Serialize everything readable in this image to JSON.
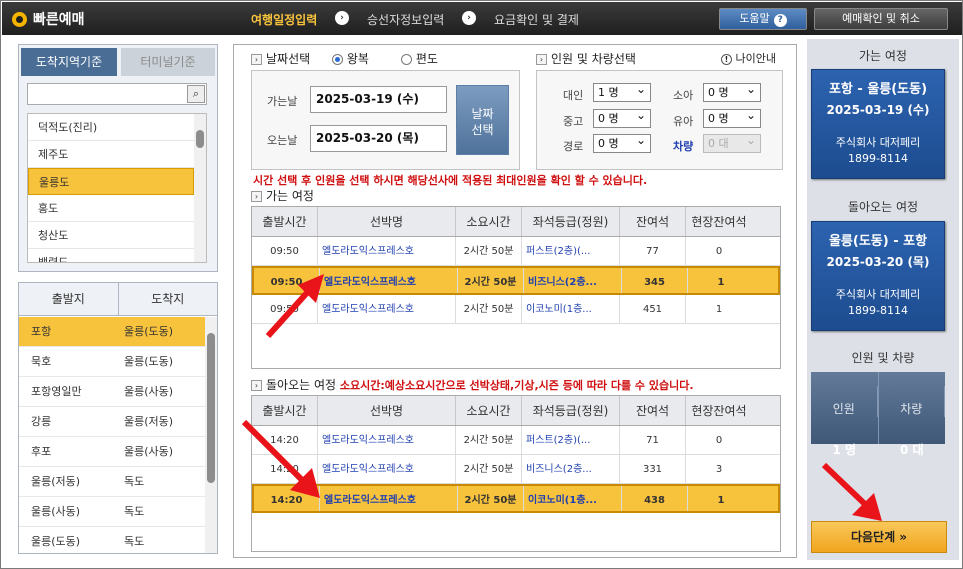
{
  "app": {
    "title": "빠른예매"
  },
  "steps": [
    {
      "label": "여행일정입력"
    },
    {
      "label": "승선자정보입력"
    },
    {
      "label": "요금확인 및 결제"
    }
  ],
  "top_buttons": {
    "help": "도움말",
    "help_icon": "?",
    "confirm": "예매확인 및 취소"
  },
  "region": {
    "tab_active": "도착지역기준",
    "tab_inactive": "터미널기준",
    "search_placeholder": "",
    "items": [
      "덕적도(진리)",
      "제주도",
      "울릉도",
      "홍도",
      "청산도",
      "백령도"
    ],
    "selected": "울릉도"
  },
  "route_list": {
    "headers": [
      "출발지",
      "도착지"
    ],
    "rows": [
      [
        "포항",
        "울릉(도동)"
      ],
      [
        "묵호",
        "울릉(도동)"
      ],
      [
        "포항영일만",
        "울릉(사동)"
      ],
      [
        "강릉",
        "울릉(저동)"
      ],
      [
        "후포",
        "울릉(사동)"
      ],
      [
        "울릉(저동)",
        "독도"
      ],
      [
        "울릉(사동)",
        "독도"
      ],
      [
        "울릉(도동)",
        "독도"
      ]
    ],
    "selected_index": 0
  },
  "date_section": {
    "title": "날짜선택",
    "radio_round": "왕복",
    "radio_oneway": "편도",
    "depart_label": "가는날",
    "depart_value": "2025-03-19 (수)",
    "return_label": "오는날",
    "return_value": "2025-03-20 (목)",
    "date_button": "날짜\n선택"
  },
  "pax_section": {
    "title": "인원 및 차량선택",
    "age_info": "나이안내",
    "age_info_icon": "!",
    "adult_label": "대인",
    "adult_value": "1 명",
    "child_label": "소아",
    "child_value": "0 명",
    "teen_label": "중고",
    "teen_value": "0 명",
    "infant_label": "유아",
    "infant_value": "0 명",
    "senior_label": "경로",
    "senior_value": "0 명",
    "vehicle_label": "차량",
    "vehicle_value": "0 대"
  },
  "notice": "시간 선택 후 인원을 선택 하시면 해당선사에 적용된 최대인원을 확인 할 수 있습니다.",
  "outbound": {
    "title": "가는 여정",
    "headers": [
      "출발시간",
      "선박명",
      "소요시간",
      "좌석등급(정원)",
      "잔여석",
      "현장잔여석"
    ],
    "rows": [
      {
        "time": "09:50",
        "ship": "엘도라도익스프레스호",
        "duration": "2시간 50분",
        "grade": "퍼스트(2층)(...",
        "seats": "77",
        "onsite": "0"
      },
      {
        "time": "09:50",
        "ship": "엘도라도익스프레스호",
        "duration": "2시간 50분",
        "grade": "비즈니스(2층...",
        "seats": "345",
        "onsite": "1"
      },
      {
        "time": "09:50",
        "ship": "엘도라도익스프레스호",
        "duration": "2시간 50분",
        "grade": "이코노미(1층...",
        "seats": "451",
        "onsite": "1"
      }
    ],
    "selected_index": 1
  },
  "inbound": {
    "title": "돌아오는 여정",
    "note": "소요시간:예상소요시간으로 선박상태,기상,시즌 등에 따라 다를 수 있습니다.",
    "headers": [
      "출발시간",
      "선박명",
      "소요시간",
      "좌석등급(정원)",
      "잔여석",
      "현장잔여석"
    ],
    "rows": [
      {
        "time": "14:20",
        "ship": "엘도라도익스프레스호",
        "duration": "2시간 50분",
        "grade": "퍼스트(2층)(...",
        "seats": "71",
        "onsite": "0"
      },
      {
        "time": "14:20",
        "ship": "엘도라도익스프레스호",
        "duration": "2시간 50분",
        "grade": "비즈니스(2층...",
        "seats": "331",
        "onsite": "3"
      },
      {
        "time": "14:20",
        "ship": "엘도라도익스프레스호",
        "duration": "2시간 50분",
        "grade": "이코노미(1층...",
        "seats": "438",
        "onsite": "1"
      }
    ],
    "selected_index": 2
  },
  "summary": {
    "out_title": "가는 여정",
    "out_route": "포항 - 울릉(도동)",
    "out_date": "2025-03-19 (수)",
    "out_company": "주식회사 대저페리",
    "out_phone": "1899-8114",
    "in_title": "돌아오는 여정",
    "in_route": "울릉(도동) - 포항",
    "in_date": "2025-03-20 (목)",
    "in_company": "주식회사 대저페리",
    "in_phone": "1899-8114",
    "pax_title": "인원 및 차량",
    "pax_label": "인원",
    "pax_value": "1 명",
    "veh_label": "차량",
    "veh_value": "0 대"
  },
  "next_button": "다음단계 »",
  "colors": {
    "accent": "#f8c33c",
    "brand_blue": "#1d4c8f",
    "annotation_red": "#e8141a"
  }
}
